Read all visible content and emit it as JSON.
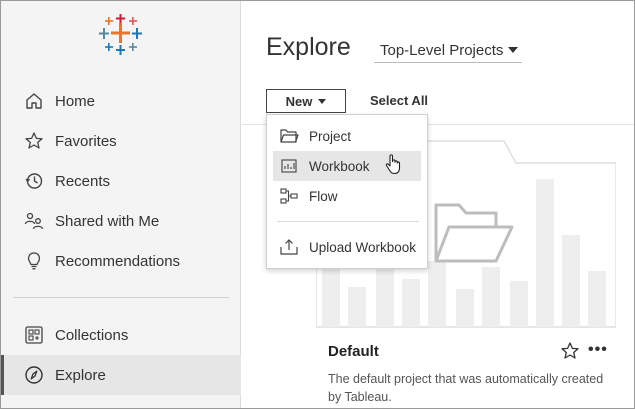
{
  "sidebar": {
    "logo_icon": "tableau-logo-icon",
    "items": [
      {
        "label": "Home",
        "icon": "home-icon"
      },
      {
        "label": "Favorites",
        "icon": "star-icon"
      },
      {
        "label": "Recents",
        "icon": "clock-icon"
      },
      {
        "label": "Shared with Me",
        "icon": "shared-users-icon"
      },
      {
        "label": "Recommendations",
        "icon": "lightbulb-icon"
      }
    ],
    "items2": [
      {
        "label": "Collections",
        "icon": "collections-icon"
      },
      {
        "label": "Explore",
        "icon": "compass-icon",
        "active": true
      }
    ]
  },
  "main": {
    "title": "Explore",
    "scope_select": "Top-Level Projects",
    "new_button": "New",
    "select_all": "Select All"
  },
  "menu": {
    "items": [
      {
        "label": "Project",
        "icon": "folder-icon"
      },
      {
        "label": "Workbook",
        "icon": "workbook-icon",
        "hover": true
      },
      {
        "label": "Flow",
        "icon": "flow-icon"
      },
      {
        "label": "Upload Workbook",
        "icon": "upload-icon"
      }
    ]
  },
  "card": {
    "title": "Default",
    "description": "The default project that was automatically created by Tableau.",
    "more_label": "•••"
  },
  "colors": {
    "sidebar_bg": "#f4f4f4",
    "active_bg": "#e6e6e6",
    "logo_orange": "#e8762d",
    "logo_blue": "#1f77b4",
    "logo_red": "#c72035",
    "logo_teal": "#5b879b"
  }
}
